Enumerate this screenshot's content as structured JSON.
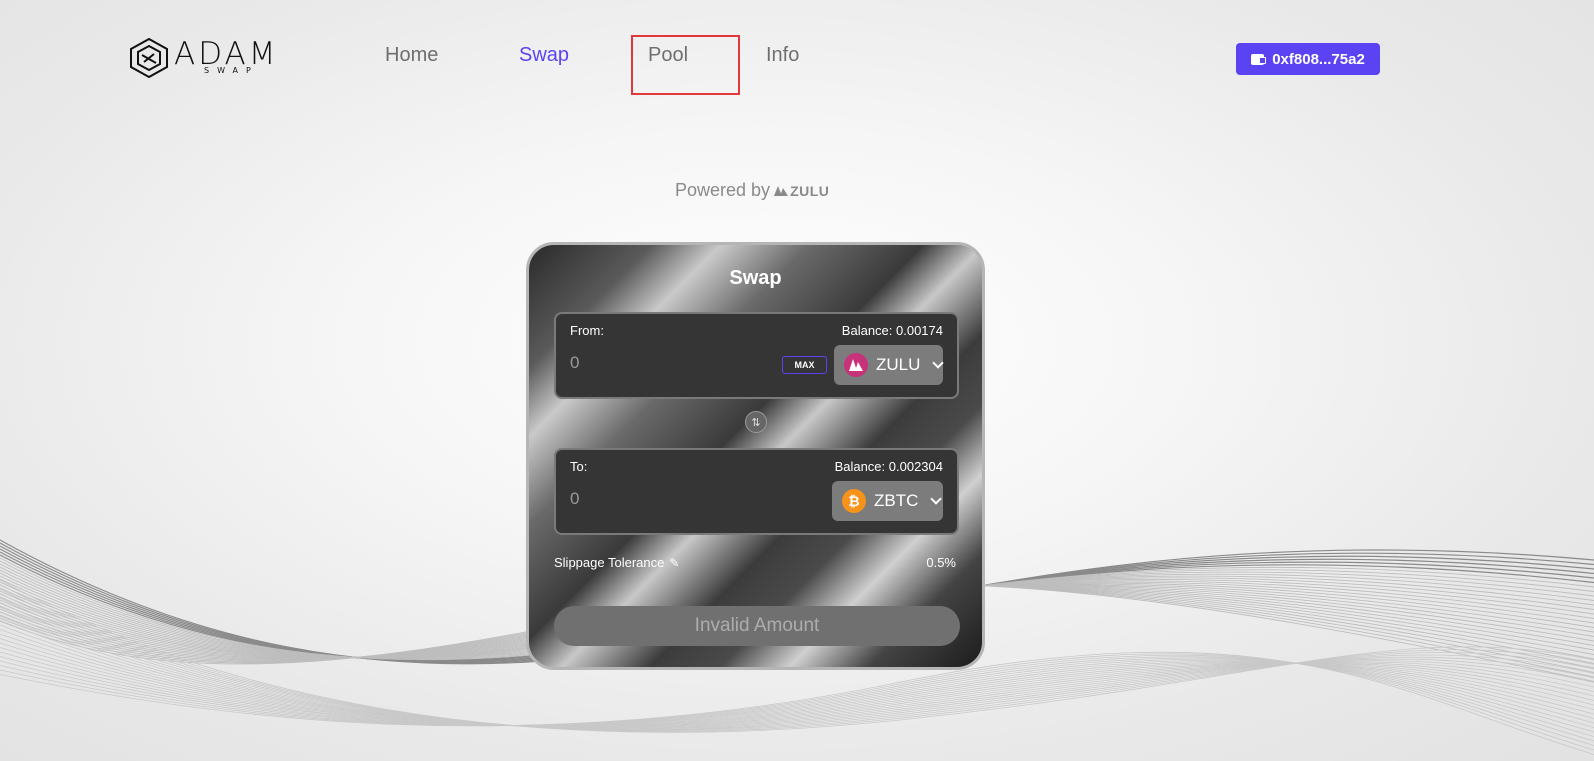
{
  "header": {
    "logo": {
      "word": "ADAM",
      "sub": "SWAP",
      "icon": "adam-swap-logo-icon"
    },
    "nav": [
      {
        "label": "Home",
        "active": false
      },
      {
        "label": "Swap",
        "active": true
      },
      {
        "label": "Pool",
        "active": false,
        "highlighted": true
      },
      {
        "label": "Info",
        "active": false
      }
    ],
    "wallet": {
      "label": "0xf808...75a2",
      "icon": "wallet-icon"
    }
  },
  "powered": {
    "text": "Powered by",
    "brand": "ZULU"
  },
  "swap": {
    "title": "Swap",
    "from": {
      "label": "From:",
      "balance": "Balance: 0.00174",
      "placeholder": "0",
      "max_label": "MAX",
      "token": "ZULU",
      "token_icon": "zulu-token-icon"
    },
    "toggle_icon": "swap-direction-icon",
    "to": {
      "label": "To:",
      "balance": "Balance: 0.002304",
      "placeholder": "0",
      "token": "ZBTC",
      "token_icon": "bitcoin-token-icon"
    },
    "slippage": {
      "label": "Slippage Tolerance",
      "value": "0.5%"
    },
    "submit_label": "Invalid Amount"
  },
  "colors": {
    "accent": "#5b43f3",
    "highlight_box": "#e0393b",
    "zulu_token": "#c8327a",
    "btc_token": "#f7931a"
  }
}
